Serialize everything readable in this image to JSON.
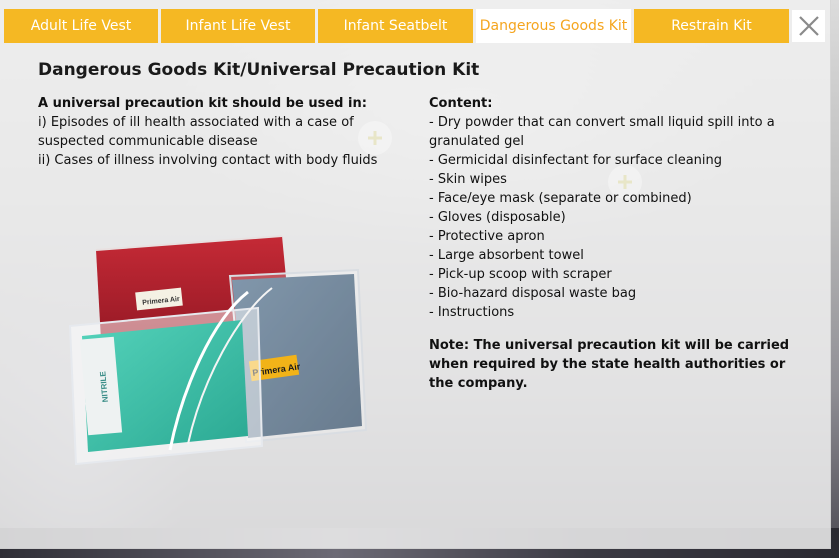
{
  "tabs": [
    {
      "label": "Adult Life Vest",
      "active": false
    },
    {
      "label": "Infant Life Vest",
      "active": false
    },
    {
      "label": "Infant Seatbelt",
      "active": false
    },
    {
      "label": "Dangerous Goods Kit",
      "active": true
    },
    {
      "label": "Restrain Kit",
      "active": false
    }
  ],
  "close_icon": "close-icon",
  "title": "Dangerous Goods Kit/Universal Precaution Kit",
  "left": {
    "heading": "A universal precaution kit should be used in:",
    "lines": [
      "i) Episodes of ill health associated with a case of suspected communicable disease",
      "ii) Cases of illness involving contact with body fluids"
    ]
  },
  "right": {
    "heading": "Content:",
    "items": [
      "- Dry powder that can convert small liquid spill into a granulated gel",
      "- Germicidal disinfectant for surface cleaning",
      "- Skin wipes",
      "- Face/eye mask (separate or combined)",
      "- Gloves (disposable)",
      "- Protective apron",
      "- Large absorbent towel",
      "- Pick-up scoop with scraper",
      "- Bio-hazard disposal waste bag",
      "- Instructions"
    ],
    "note": "Note: The universal precaution kit will be carried when required by the state health authorities or the company."
  },
  "image": {
    "brand_label_1": "Primera Air",
    "brand_label_2": "Primera Air",
    "glove_label": "NITRILE"
  },
  "colors": {
    "tab_bg": "#f5b823",
    "tab_active_text": "#f5a51e",
    "pouch_red": "#b3202c",
    "bag_blue": "#4f6b86",
    "gloves_teal": "#3bbfa7"
  }
}
